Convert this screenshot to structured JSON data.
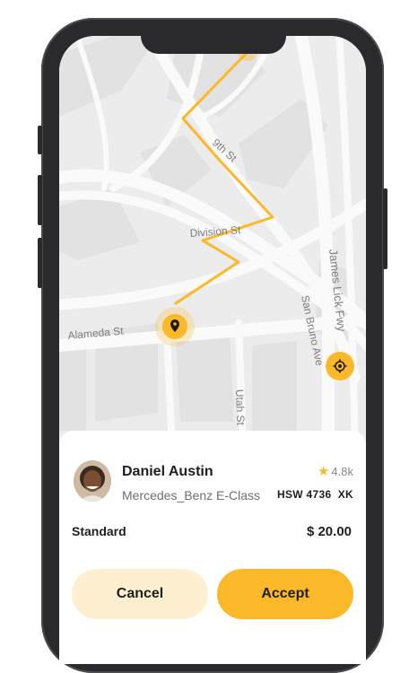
{
  "map": {
    "streets": [
      "9th St",
      "Division St",
      "Alameda St",
      "San Bruno Ave",
      "James Lick Fwy",
      "Utah St"
    ],
    "route_color": "#fbb829"
  },
  "driver": {
    "name": "Daniel Austin",
    "car": "Mercedes_Benz E-Class",
    "rating": "4.8k",
    "plate": "HSW 4736  XK"
  },
  "ride": {
    "type": "Standard",
    "price": "$ 20.00"
  },
  "actions": {
    "cancel_label": "Cancel",
    "accept_label": "Accept"
  },
  "colors": {
    "accent": "#fbb829",
    "accent_light": "#fdefd0"
  }
}
